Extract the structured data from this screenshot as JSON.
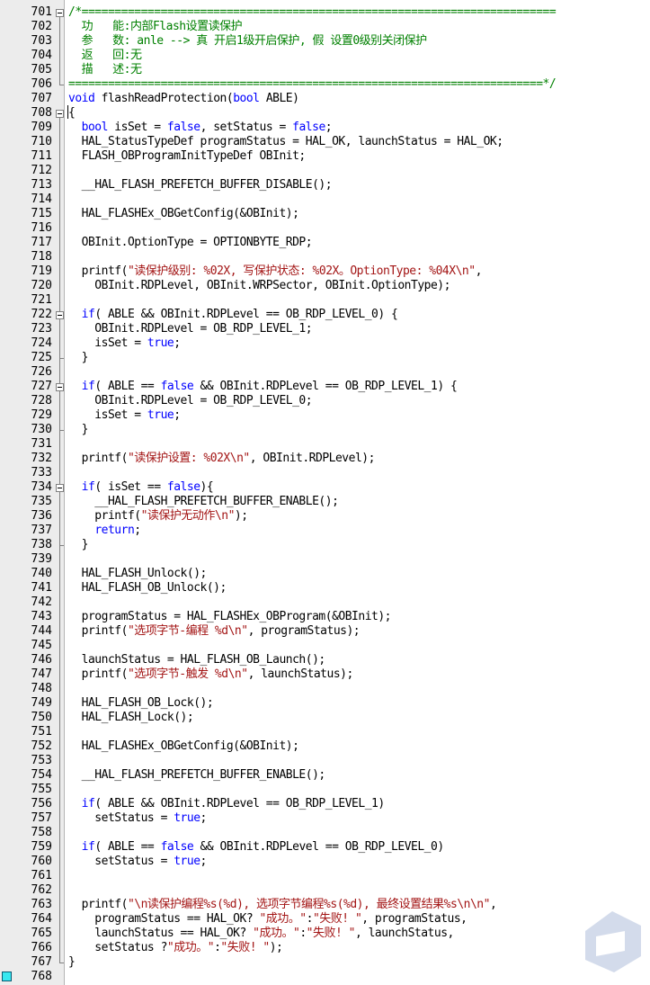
{
  "editor": {
    "colors": {
      "keyword": "#0000ff",
      "string": "#a31515",
      "comment": "#008000",
      "gutter": "#ececec",
      "bookmark": "#38e8f0"
    },
    "bookmark_line": "768",
    "lines": [
      {
        "n": "701",
        "t": [
          {
            "c": "cm",
            "v": "/*========================================================================"
          }
        ]
      },
      {
        "n": "702",
        "t": [
          {
            "c": "cm",
            "v": "  功   能:内部Flash设置读保护"
          }
        ]
      },
      {
        "n": "703",
        "t": [
          {
            "c": "cm",
            "v": "  参   数: anle --> 真 开启1级开启保护, 假 设置0级别关闭保护"
          }
        ]
      },
      {
        "n": "704",
        "t": [
          {
            "c": "cm",
            "v": "  返   回:无"
          }
        ]
      },
      {
        "n": "705",
        "t": [
          {
            "c": "cm",
            "v": "  描   述:无"
          }
        ]
      },
      {
        "n": "706",
        "t": [
          {
            "c": "cm",
            "v": "========================================================================*/"
          }
        ]
      },
      {
        "n": "707",
        "t": [
          {
            "c": "kw",
            "v": "void"
          },
          {
            "c": "",
            "v": " flashReadProtection("
          },
          {
            "c": "kw",
            "v": "bool"
          },
          {
            "c": "",
            "v": " ABLE)"
          }
        ]
      },
      {
        "n": "708",
        "t": [
          {
            "c": "",
            "v": "{"
          }
        ]
      },
      {
        "n": "709",
        "t": [
          {
            "c": "",
            "v": "  "
          },
          {
            "c": "kw",
            "v": "bool"
          },
          {
            "c": "",
            "v": " isSet = "
          },
          {
            "c": "kw",
            "v": "false"
          },
          {
            "c": "",
            "v": ", setStatus = "
          },
          {
            "c": "kw",
            "v": "false"
          },
          {
            "c": "",
            "v": ";"
          }
        ]
      },
      {
        "n": "710",
        "t": [
          {
            "c": "",
            "v": "  HAL_StatusTypeDef programStatus = HAL_OK, launchStatus = HAL_OK;"
          }
        ]
      },
      {
        "n": "711",
        "t": [
          {
            "c": "",
            "v": "  FLASH_OBProgramInitTypeDef OBInit;"
          }
        ]
      },
      {
        "n": "712",
        "t": []
      },
      {
        "n": "713",
        "t": [
          {
            "c": "",
            "v": "  __HAL_FLASH_PREFETCH_BUFFER_DISABLE();"
          }
        ]
      },
      {
        "n": "714",
        "t": []
      },
      {
        "n": "715",
        "t": [
          {
            "c": "",
            "v": "  HAL_FLASHEx_OBGetConfig(&OBInit);"
          }
        ]
      },
      {
        "n": "716",
        "t": []
      },
      {
        "n": "717",
        "t": [
          {
            "c": "",
            "v": "  OBInit.OptionType = OPTIONBYTE_RDP;"
          }
        ]
      },
      {
        "n": "718",
        "t": []
      },
      {
        "n": "719",
        "t": [
          {
            "c": "",
            "v": "  printf("
          },
          {
            "c": "str",
            "v": "\"读保护级别: %02X, 写保护状态: %02X。OptionType: %04X\\n\""
          },
          {
            "c": "",
            "v": ","
          }
        ]
      },
      {
        "n": "720",
        "t": [
          {
            "c": "",
            "v": "    OBInit.RDPLevel, OBInit.WRPSector, OBInit.OptionType);"
          }
        ]
      },
      {
        "n": "721",
        "t": []
      },
      {
        "n": "722",
        "t": [
          {
            "c": "",
            "v": "  "
          },
          {
            "c": "kw",
            "v": "if"
          },
          {
            "c": "",
            "v": "( ABLE && OBInit.RDPLevel == OB_RDP_LEVEL_0) {"
          }
        ]
      },
      {
        "n": "723",
        "t": [
          {
            "c": "",
            "v": "    OBInit.RDPLevel = OB_RDP_LEVEL_1;"
          }
        ]
      },
      {
        "n": "724",
        "t": [
          {
            "c": "",
            "v": "    isSet = "
          },
          {
            "c": "kw",
            "v": "true"
          },
          {
            "c": "",
            "v": ";"
          }
        ]
      },
      {
        "n": "725",
        "t": [
          {
            "c": "",
            "v": "  }"
          }
        ]
      },
      {
        "n": "726",
        "t": []
      },
      {
        "n": "727",
        "t": [
          {
            "c": "",
            "v": "  "
          },
          {
            "c": "kw",
            "v": "if"
          },
          {
            "c": "",
            "v": "( ABLE == "
          },
          {
            "c": "kw",
            "v": "false"
          },
          {
            "c": "",
            "v": " && OBInit.RDPLevel == OB_RDP_LEVEL_1) {"
          }
        ]
      },
      {
        "n": "728",
        "t": [
          {
            "c": "",
            "v": "    OBInit.RDPLevel = OB_RDP_LEVEL_0;"
          }
        ]
      },
      {
        "n": "729",
        "t": [
          {
            "c": "",
            "v": "    isSet = "
          },
          {
            "c": "kw",
            "v": "true"
          },
          {
            "c": "",
            "v": ";"
          }
        ]
      },
      {
        "n": "730",
        "t": [
          {
            "c": "",
            "v": "  }"
          }
        ]
      },
      {
        "n": "731",
        "t": []
      },
      {
        "n": "732",
        "t": [
          {
            "c": "",
            "v": "  printf("
          },
          {
            "c": "str",
            "v": "\"读保护设置: %02X\\n\""
          },
          {
            "c": "",
            "v": ", OBInit.RDPLevel);"
          }
        ]
      },
      {
        "n": "733",
        "t": []
      },
      {
        "n": "734",
        "t": [
          {
            "c": "",
            "v": "  "
          },
          {
            "c": "kw",
            "v": "if"
          },
          {
            "c": "",
            "v": "( isSet == "
          },
          {
            "c": "kw",
            "v": "false"
          },
          {
            "c": "",
            "v": "){"
          }
        ]
      },
      {
        "n": "735",
        "t": [
          {
            "c": "",
            "v": "    __HAL_FLASH_PREFETCH_BUFFER_ENABLE();"
          }
        ]
      },
      {
        "n": "736",
        "t": [
          {
            "c": "",
            "v": "    printf("
          },
          {
            "c": "str",
            "v": "\"读保护无动作\\n\""
          },
          {
            "c": "",
            "v": ");"
          }
        ]
      },
      {
        "n": "737",
        "t": [
          {
            "c": "",
            "v": "    "
          },
          {
            "c": "kw",
            "v": "return"
          },
          {
            "c": "",
            "v": ";"
          }
        ]
      },
      {
        "n": "738",
        "t": [
          {
            "c": "",
            "v": "  }"
          }
        ]
      },
      {
        "n": "739",
        "t": []
      },
      {
        "n": "740",
        "t": [
          {
            "c": "",
            "v": "  HAL_FLASH_Unlock();"
          }
        ]
      },
      {
        "n": "741",
        "t": [
          {
            "c": "",
            "v": "  HAL_FLASH_OB_Unlock();"
          }
        ]
      },
      {
        "n": "742",
        "t": []
      },
      {
        "n": "743",
        "t": [
          {
            "c": "",
            "v": "  programStatus = HAL_FLASHEx_OBProgram(&OBInit);"
          }
        ]
      },
      {
        "n": "744",
        "t": [
          {
            "c": "",
            "v": "  printf("
          },
          {
            "c": "str",
            "v": "\"选项字节-编程 %d\\n\""
          },
          {
            "c": "",
            "v": ", programStatus);"
          }
        ]
      },
      {
        "n": "745",
        "t": []
      },
      {
        "n": "746",
        "t": [
          {
            "c": "",
            "v": "  launchStatus = HAL_FLASH_OB_Launch();"
          }
        ]
      },
      {
        "n": "747",
        "t": [
          {
            "c": "",
            "v": "  printf("
          },
          {
            "c": "str",
            "v": "\"选项字节-触发 %d\\n\""
          },
          {
            "c": "",
            "v": ", launchStatus);"
          }
        ]
      },
      {
        "n": "748",
        "t": []
      },
      {
        "n": "749",
        "t": [
          {
            "c": "",
            "v": "  HAL_FLASH_OB_Lock();"
          }
        ]
      },
      {
        "n": "750",
        "t": [
          {
            "c": "",
            "v": "  HAL_FLASH_Lock();"
          }
        ]
      },
      {
        "n": "751",
        "t": []
      },
      {
        "n": "752",
        "t": [
          {
            "c": "",
            "v": "  HAL_FLASHEx_OBGetConfig(&OBInit);"
          }
        ]
      },
      {
        "n": "753",
        "t": []
      },
      {
        "n": "754",
        "t": [
          {
            "c": "",
            "v": "  __HAL_FLASH_PREFETCH_BUFFER_ENABLE();"
          }
        ]
      },
      {
        "n": "755",
        "t": []
      },
      {
        "n": "756",
        "t": [
          {
            "c": "",
            "v": "  "
          },
          {
            "c": "kw",
            "v": "if"
          },
          {
            "c": "",
            "v": "( ABLE && OBInit.RDPLevel == OB_RDP_LEVEL_1)"
          }
        ]
      },
      {
        "n": "757",
        "t": [
          {
            "c": "",
            "v": "    setStatus = "
          },
          {
            "c": "kw",
            "v": "true"
          },
          {
            "c": "",
            "v": ";"
          }
        ]
      },
      {
        "n": "758",
        "t": []
      },
      {
        "n": "759",
        "t": [
          {
            "c": "",
            "v": "  "
          },
          {
            "c": "kw",
            "v": "if"
          },
          {
            "c": "",
            "v": "( ABLE == "
          },
          {
            "c": "kw",
            "v": "false"
          },
          {
            "c": "",
            "v": " && OBInit.RDPLevel == OB_RDP_LEVEL_0)"
          }
        ]
      },
      {
        "n": "760",
        "t": [
          {
            "c": "",
            "v": "    setStatus = "
          },
          {
            "c": "kw",
            "v": "true"
          },
          {
            "c": "",
            "v": ";"
          }
        ]
      },
      {
        "n": "761",
        "t": []
      },
      {
        "n": "762",
        "t": []
      },
      {
        "n": "763",
        "t": [
          {
            "c": "",
            "v": "  printf("
          },
          {
            "c": "str",
            "v": "\"\\n读保护编程%s(%d), 选项字节编程%s(%d), 最终设置结果%s\\n\\n\""
          },
          {
            "c": "",
            "v": ","
          }
        ]
      },
      {
        "n": "764",
        "t": [
          {
            "c": "",
            "v": "    programStatus == HAL_OK? "
          },
          {
            "c": "str",
            "v": "\"成功。\""
          },
          {
            "c": "",
            "v": ":"
          },
          {
            "c": "str",
            "v": "\"失败! \""
          },
          {
            "c": "",
            "v": ", programStatus,"
          }
        ]
      },
      {
        "n": "765",
        "t": [
          {
            "c": "",
            "v": "    launchStatus == HAL_OK? "
          },
          {
            "c": "str",
            "v": "\"成功。\""
          },
          {
            "c": "",
            "v": ":"
          },
          {
            "c": "str",
            "v": "\"失败! \""
          },
          {
            "c": "",
            "v": ", launchStatus,"
          }
        ]
      },
      {
        "n": "766",
        "t": [
          {
            "c": "",
            "v": "    setStatus ?"
          },
          {
            "c": "str",
            "v": "\"成功。\""
          },
          {
            "c": "",
            "v": ":"
          },
          {
            "c": "str",
            "v": "\"失败! \""
          },
          {
            "c": "",
            "v": ");"
          }
        ]
      },
      {
        "n": "767",
        "t": [
          {
            "c": "",
            "v": "}"
          }
        ]
      },
      {
        "n": "768",
        "t": []
      }
    ]
  }
}
